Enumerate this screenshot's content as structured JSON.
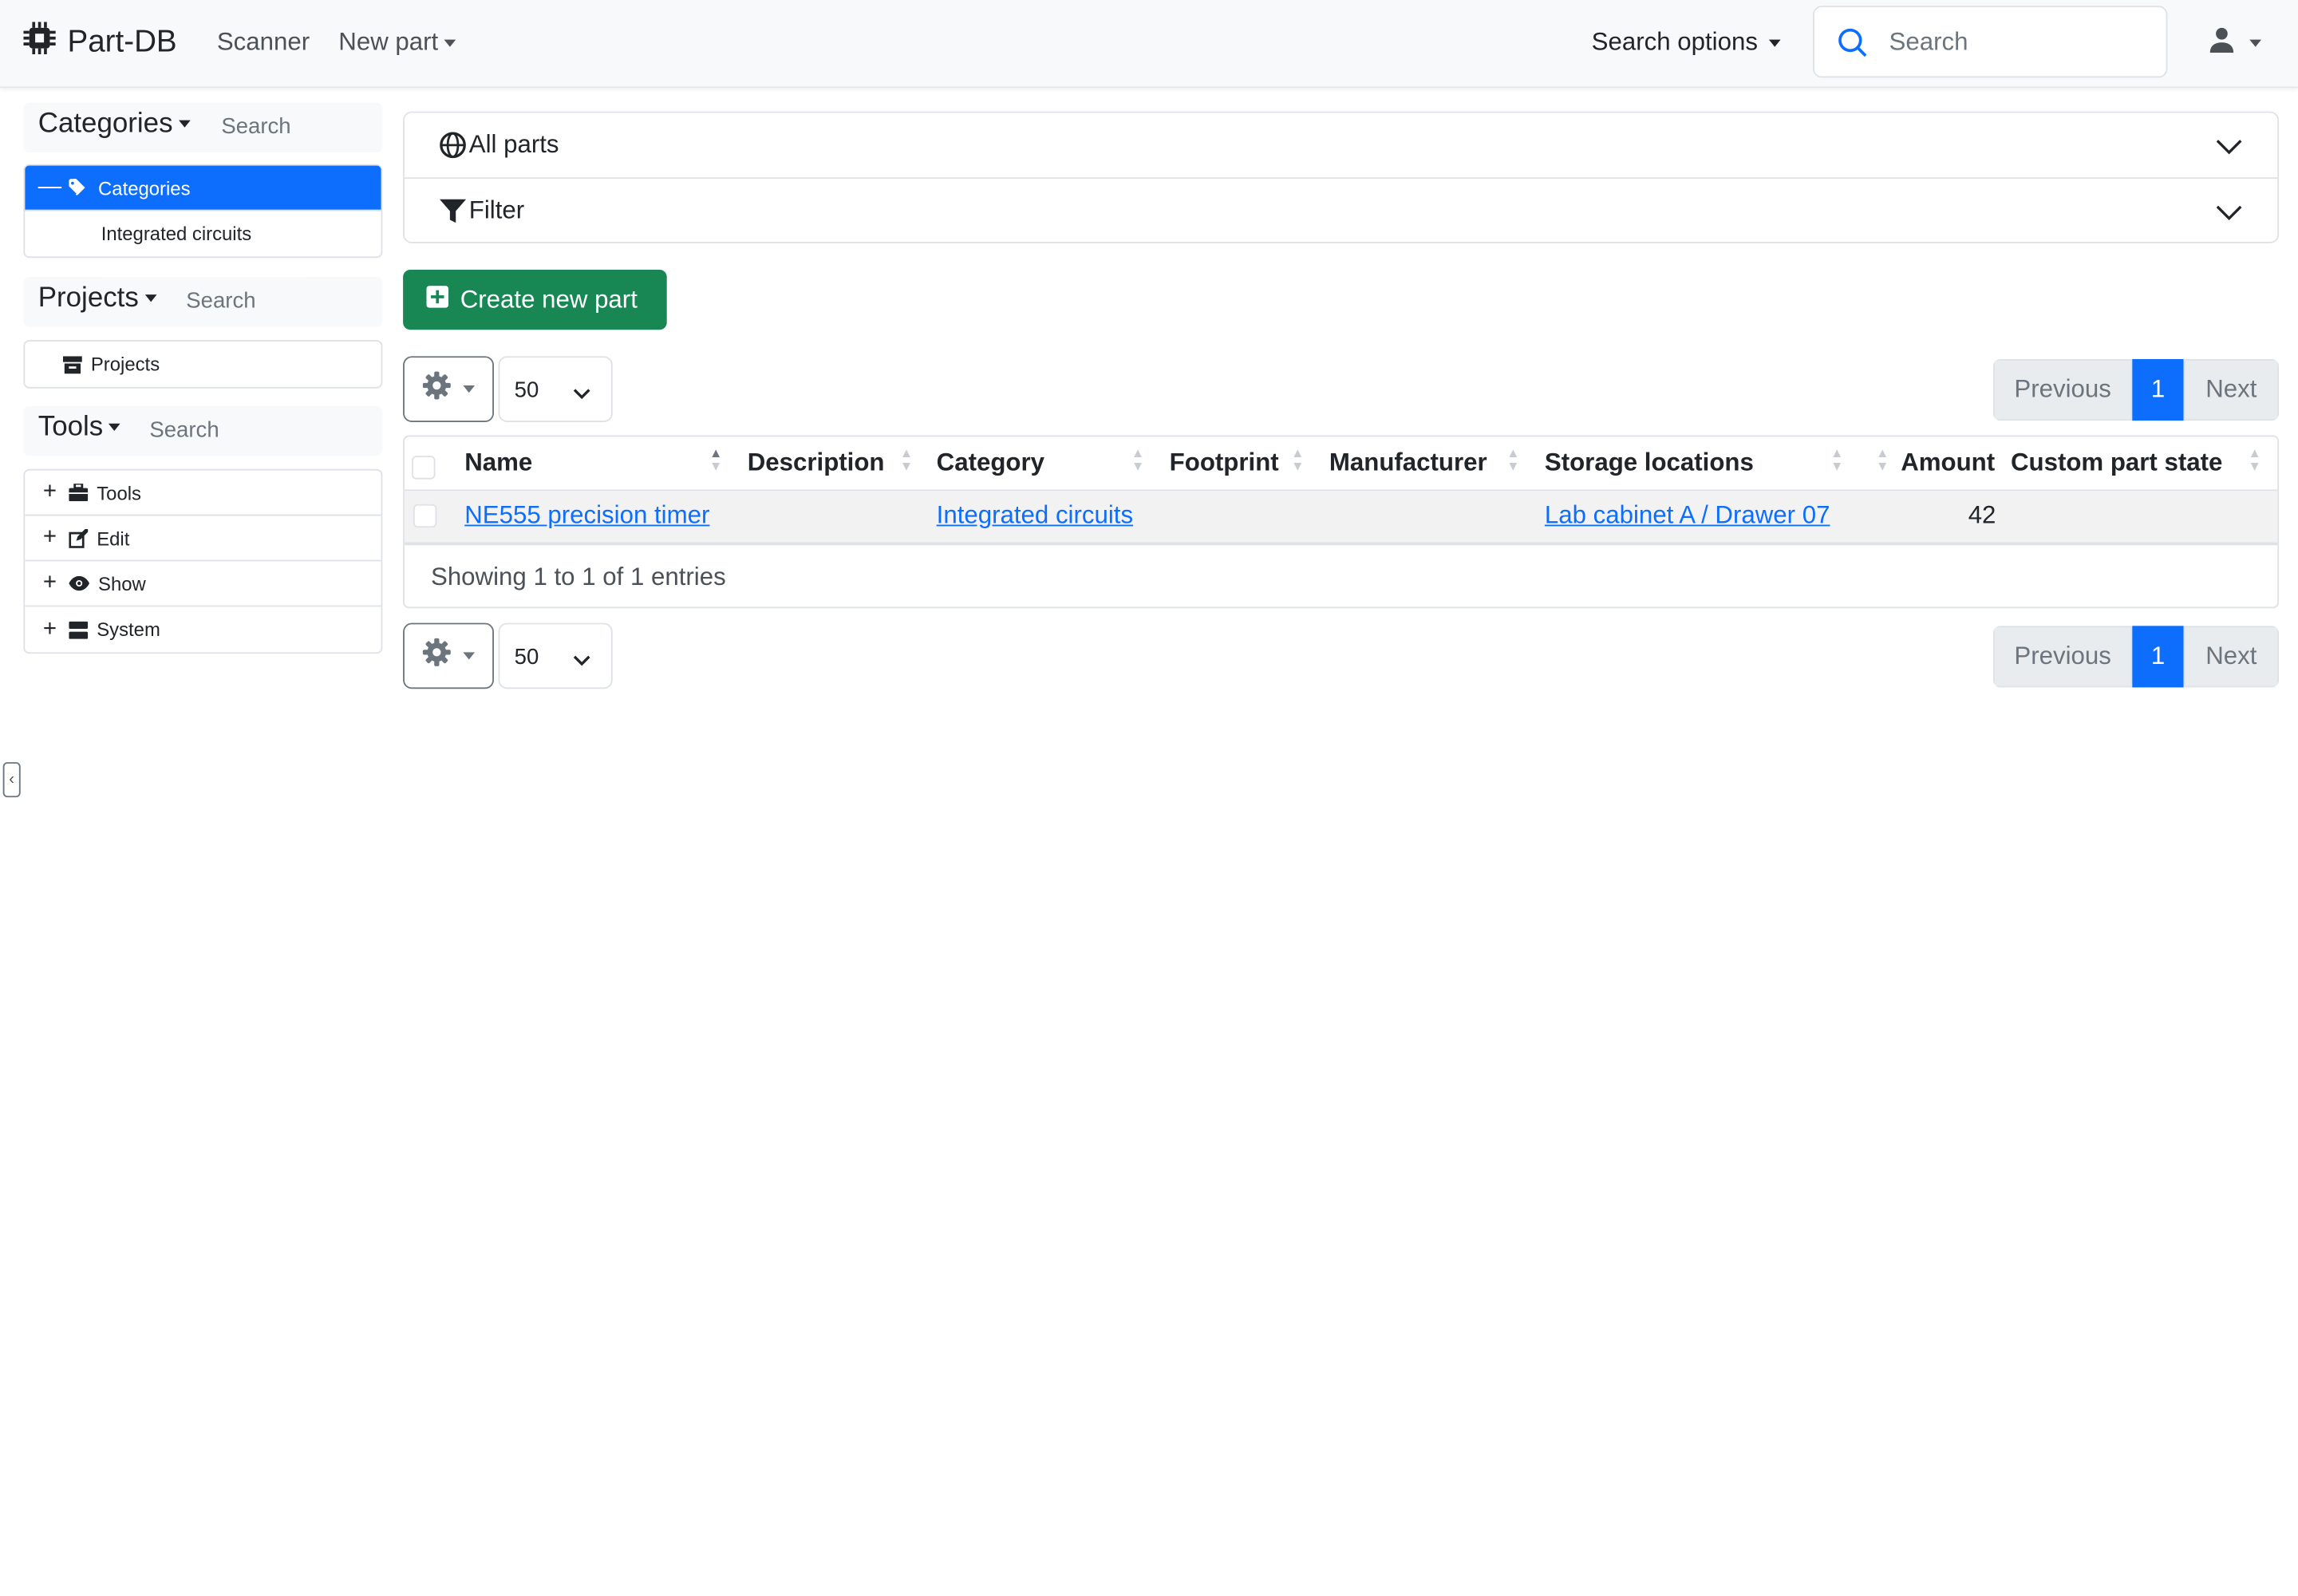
{
  "navbar": {
    "brand": "Part-DB",
    "links": [
      "Scanner",
      "New part"
    ],
    "search_options": "Search options",
    "search_placeholder": "Search"
  },
  "sidebar": {
    "categories": {
      "title": "Categories",
      "search": "Search",
      "items": [
        {
          "label": "Categories",
          "active": true
        },
        {
          "label": "Integrated circuits"
        }
      ]
    },
    "projects": {
      "title": "Projects",
      "search": "Search",
      "items": [
        {
          "label": "Projects"
        }
      ]
    },
    "tools": {
      "title": "Tools",
      "search": "Search",
      "items": [
        {
          "label": "Tools"
        },
        {
          "label": "Edit"
        },
        {
          "label": "Show"
        },
        {
          "label": "System"
        }
      ]
    }
  },
  "main": {
    "accordion": {
      "all_parts": "All parts",
      "filter": "Filter"
    },
    "create_button": "Create new part",
    "page_size": "50",
    "pager": {
      "previous": "Previous",
      "current": "1",
      "next": "Next"
    },
    "table": {
      "columns": [
        "Name",
        "Description",
        "Category",
        "Footprint",
        "Manufacturer",
        "Storage locations",
        "Amount",
        "Custom part state"
      ],
      "rows": [
        {
          "name": "NE555 precision timer",
          "description": "",
          "category": "Integrated circuits",
          "footprint": "",
          "manufacturer": "",
          "storage": "Lab cabinet A / Drawer 07",
          "amount": "42",
          "state": ""
        }
      ],
      "info": "Showing 1 to 1 of 1 entries"
    }
  },
  "colors": {
    "primary": "#0d6efd",
    "success": "#198754"
  }
}
